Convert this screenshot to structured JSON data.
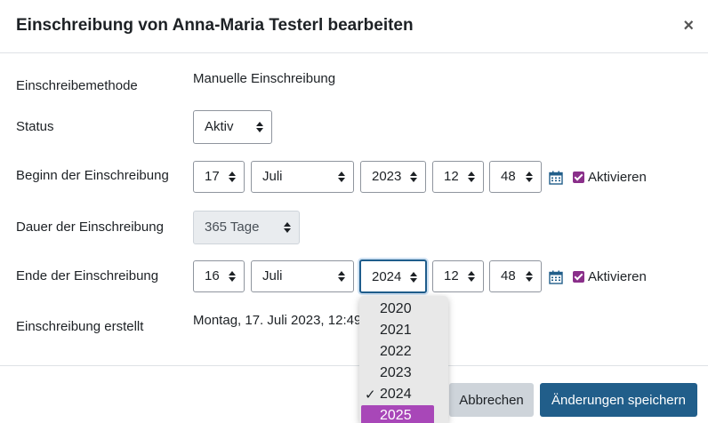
{
  "dialog": {
    "title": "Einschreibung von Anna-Maria Testerl bearbeiten",
    "close_label": "×"
  },
  "form": {
    "method": {
      "label": "Einschreibemethode",
      "value": "Manuelle Einschreibung"
    },
    "status": {
      "label": "Status",
      "value": "Aktiv"
    },
    "start": {
      "label": "Beginn der Einschreibung",
      "day": "17",
      "month": "Juli",
      "year": "2023",
      "hour": "12",
      "minute": "48",
      "enable_label": "Aktivieren",
      "enabled": true
    },
    "duration": {
      "label": "Dauer der Einschreibung",
      "value": "365 Tage",
      "disabled": true
    },
    "end": {
      "label": "Ende der Einschreibung",
      "day": "16",
      "month": "Juli",
      "year": "2024",
      "hour": "12",
      "minute": "48",
      "enable_label": "Aktivieren",
      "enabled": true
    },
    "created": {
      "label": "Einschreibung erstellt",
      "value": "Montag, 17. Juli 2023, 12:49"
    }
  },
  "year_dropdown": {
    "options": [
      {
        "label": "2020",
        "mark": ""
      },
      {
        "label": "2021",
        "mark": ""
      },
      {
        "label": "2022",
        "mark": ""
      },
      {
        "label": "2023",
        "mark": ""
      },
      {
        "label": "2024",
        "mark": "✓"
      },
      {
        "label": "2025",
        "mark": ""
      }
    ],
    "selected": "2024",
    "highlighted": "2025",
    "highlight_color": "#a847b8"
  },
  "footer": {
    "cancel_label": "Abbrechen",
    "save_label": "Änderungen speichern"
  },
  "colors": {
    "primary": "#215e8a",
    "checkbox": "#8a2f8a",
    "icon": "#215e8a"
  },
  "icons": {
    "calendar": "calendar-icon",
    "close": "close-icon",
    "select": "chevron-updown-icon",
    "check": "checkmark-icon"
  }
}
